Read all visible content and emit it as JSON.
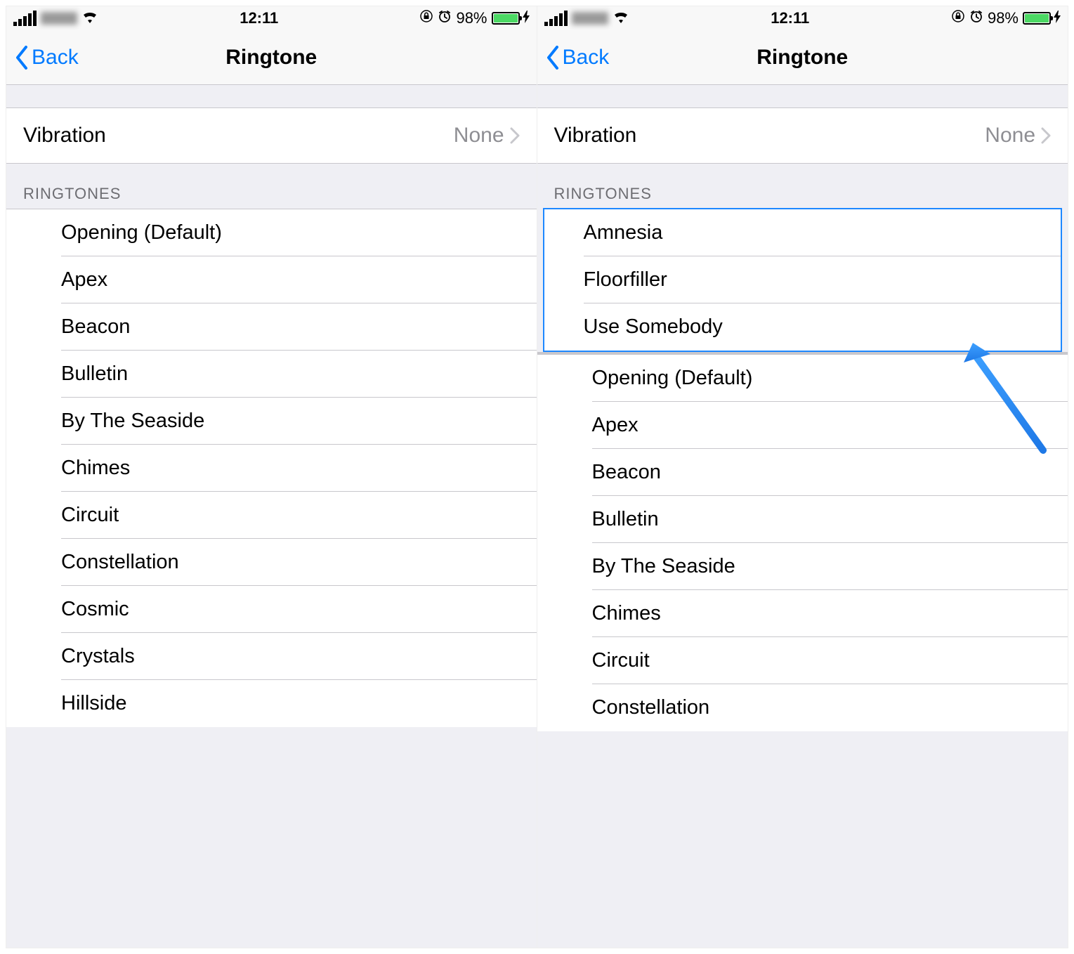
{
  "status": {
    "time": "12:11",
    "battery_pct": "98%"
  },
  "nav": {
    "back_label": "Back",
    "title": "Ringtone"
  },
  "vibration": {
    "label": "Vibration",
    "value": "None"
  },
  "section": {
    "ringtones_label": "RINGTONES"
  },
  "left_list": [
    "Opening (Default)",
    "Apex",
    "Beacon",
    "Bulletin",
    "By The Seaside",
    "Chimes",
    "Circuit",
    "Constellation",
    "Cosmic",
    "Crystals",
    "Hillside"
  ],
  "right_custom": [
    "Amnesia",
    "Floorfiller",
    "Use Somebody"
  ],
  "right_list": [
    "Opening (Default)",
    "Apex",
    "Beacon",
    "Bulletin",
    "By The Seaside",
    "Chimes",
    "Circuit",
    "Constellation"
  ]
}
